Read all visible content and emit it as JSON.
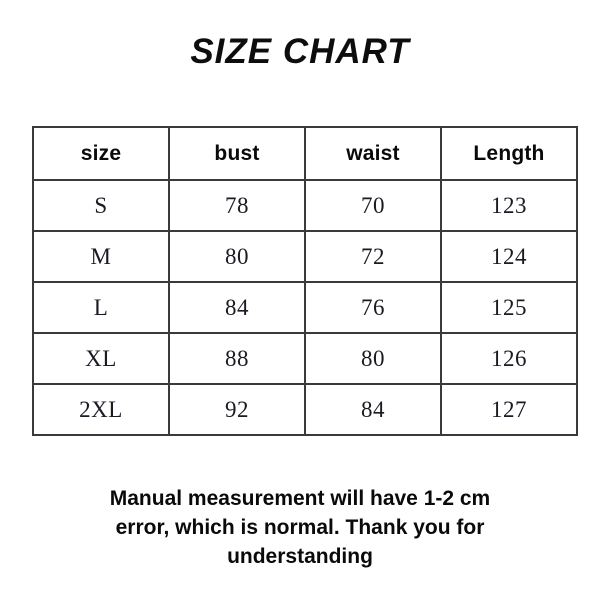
{
  "title": "SIZE CHART",
  "table": {
    "columns": [
      "size",
      "bust",
      "waist",
      "Length"
    ],
    "rows": [
      {
        "size": "S",
        "bust": "78",
        "waist": "70",
        "length": "123"
      },
      {
        "size": "M",
        "bust": "80",
        "waist": "72",
        "length": "124"
      },
      {
        "size": "L",
        "bust": "84",
        "waist": "76",
        "length": "125"
      },
      {
        "size": "XL",
        "bust": "88",
        "waist": "80",
        "length": "126"
      },
      {
        "size": "2XL",
        "bust": "92",
        "waist": "84",
        "length": "127"
      }
    ]
  },
  "footer": {
    "lines": [
      "Manual measurement will have 1-2 cm",
      "error, which is normal. Thank you for",
      "understanding"
    ]
  },
  "colors": {
    "background": "#ffffff",
    "text": "#0a0a0a",
    "cell_text": "#1a1a22",
    "border": "#3a3a3a"
  },
  "chart_data": {
    "type": "table",
    "title": "SIZE CHART",
    "columns": [
      "size",
      "bust",
      "waist",
      "Length"
    ],
    "rows": [
      [
        "S",
        78,
        70,
        123
      ],
      [
        "M",
        80,
        72,
        124
      ],
      [
        "L",
        84,
        76,
        125
      ],
      [
        "XL",
        88,
        80,
        126
      ],
      [
        "2XL",
        92,
        84,
        127
      ]
    ],
    "units": "cm",
    "note": "Manual measurement will have 1-2 cm error, which is normal. Thank you for understanding"
  }
}
